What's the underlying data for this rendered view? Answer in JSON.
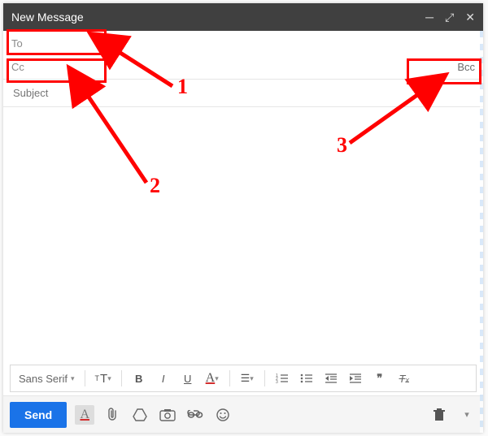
{
  "header": {
    "title": "New Message"
  },
  "fields": {
    "to_placeholder": "To",
    "cc_placeholder": "Cc",
    "bcc_label": "Bcc",
    "subject_placeholder": "Subject"
  },
  "annotations": {
    "n1": "1",
    "n2": "2",
    "n3": "3"
  },
  "format": {
    "font": "Sans Serif",
    "quote": "❝❞"
  },
  "bottom": {
    "send": "Send"
  }
}
